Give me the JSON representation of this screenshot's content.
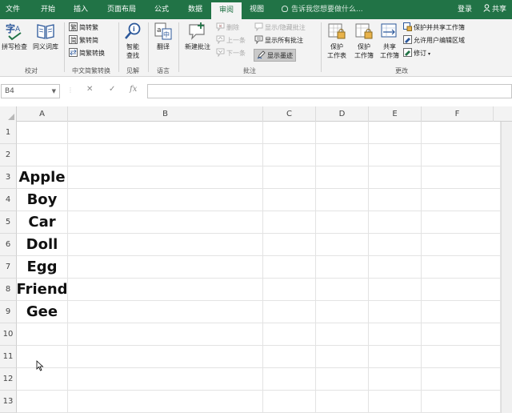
{
  "tabs": [
    "文件",
    "开始",
    "插入",
    "页面布局",
    "公式",
    "数据",
    "审阅",
    "视图"
  ],
  "active_tab": "审阅",
  "tell_me": "告诉我您想要做什么...",
  "login": "登录",
  "share": "共享",
  "ribbon": {
    "spell_check": "拼写检查",
    "thesaurus": "同义词库",
    "group_proofing": "校对",
    "to_traditional": "简转繁",
    "to_simplified": "繁转简",
    "convert": "简繁转换",
    "group_chinese": "中文简繁转换",
    "smart_lookup_1": "智能",
    "smart_lookup_2": "查找",
    "group_insights": "见解",
    "translate": "翻译",
    "group_language": "语言",
    "new_comment": "新建批注",
    "delete": "删除",
    "previous": "上一条",
    "next": "下一条",
    "show_hide_comment": "显示/隐藏批注",
    "show_all_comments": "显示所有批注",
    "show_ink": "显示墨迹",
    "group_comments": "批注",
    "protect_sheet_1": "保护",
    "protect_sheet_2": "工作表",
    "protect_workbook_1": "保护",
    "protect_workbook_2": "工作簿",
    "share_workbook_1": "共享",
    "share_workbook_2": "工作簿",
    "protect_share": "保护并共享工作簿",
    "allow_edit": "允许用户编辑区域",
    "track_changes": "修订",
    "group_changes": "更改"
  },
  "formula_bar": {
    "name_box": "B4",
    "cancel": "✕",
    "enter": "✓",
    "fx": "fx",
    "value": ""
  },
  "columns": [
    "A",
    "B",
    "C",
    "D",
    "E",
    "F"
  ],
  "rows": [
    "1",
    "2",
    "3",
    "4",
    "5",
    "6",
    "7",
    "8",
    "9",
    "10",
    "11",
    "12",
    "13"
  ],
  "cells_a": [
    "",
    "",
    "Apple",
    "Boy",
    "Car",
    "Doll",
    "Egg",
    "Friend",
    "Gee",
    "",
    "",
    "",
    ""
  ],
  "colors": {
    "accent": "#217346",
    "ribbon_bg": "#f3f3f3",
    "header_bg": "#f3f3f3"
  }
}
